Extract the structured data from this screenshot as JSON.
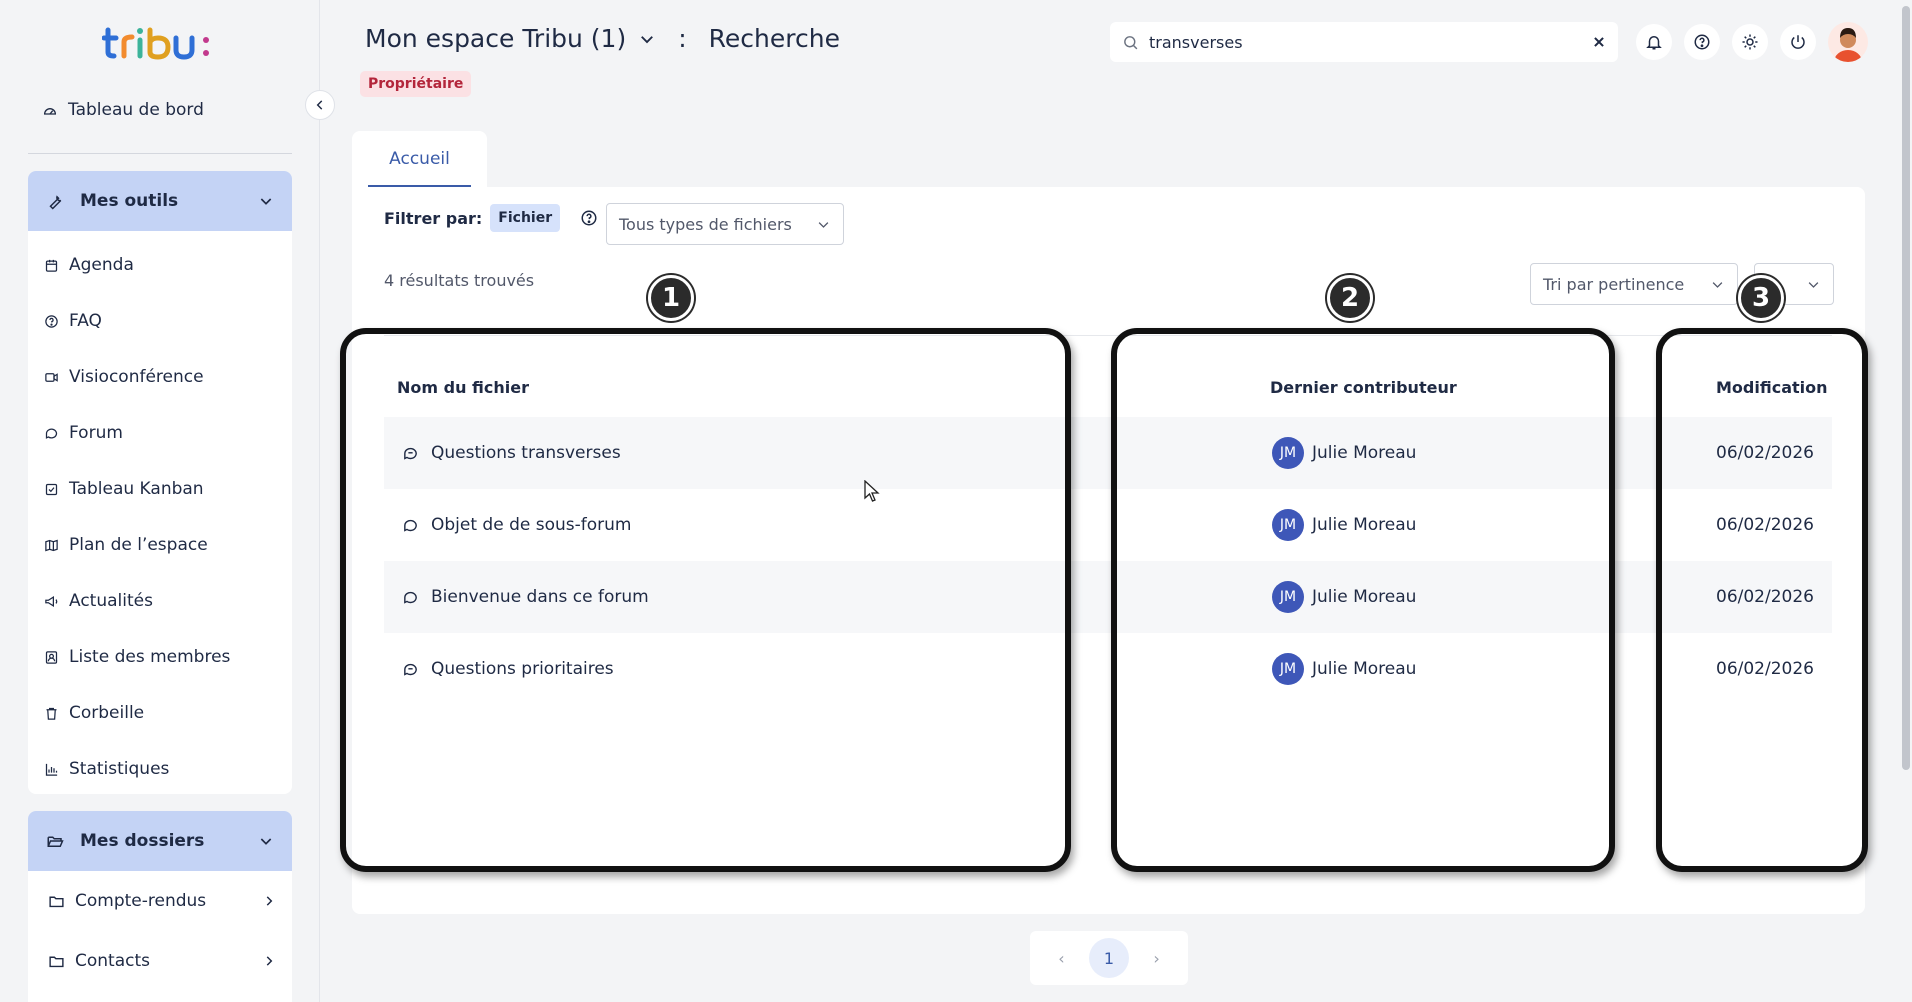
{
  "sidebar": {
    "dashboard_label": "Tableau de bord",
    "tools": {
      "header": "Mes outils",
      "items": [
        "Agenda",
        "FAQ",
        "Visioconférence",
        "Forum",
        "Tableau Kanban",
        "Plan de l’espace",
        "Actualités",
        "Liste des membres",
        "Corbeille",
        "Statistiques"
      ]
    },
    "folders": {
      "header": "Mes dossiers",
      "items": [
        "Compte-rendus",
        "Contacts"
      ]
    }
  },
  "header": {
    "space_title": "Mon espace Tribu (1)",
    "separator": ":",
    "page_title": "Recherche",
    "role_badge": "Propriétaire",
    "search_value": "transverses"
  },
  "tabs": {
    "home": "Accueil"
  },
  "filter": {
    "label": "Filtrer par:",
    "chip": "Fichier",
    "type_select": "Tous types de fichiers",
    "sort_select": "Tri par pertinence",
    "results_count": "4 résultats trouvés"
  },
  "table": {
    "headers": {
      "name": "Nom du fichier",
      "contributor": "Dernier contributeur",
      "modified": "Modification"
    },
    "rows": [
      {
        "name": "Questions transverses",
        "icon": "forum-icon",
        "initials": "JM",
        "contributor": "Julie Moreau",
        "date": "06/02/2026"
      },
      {
        "name": "Objet de de sous-forum",
        "icon": "comment-icon",
        "initials": "JM",
        "contributor": "Julie Moreau",
        "date": "06/02/2026"
      },
      {
        "name": "Bienvenue dans ce forum",
        "icon": "comment-icon",
        "initials": "JM",
        "contributor": "Julie Moreau",
        "date": "06/02/2026"
      },
      {
        "name": "Questions prioritaires",
        "icon": "forum-icon",
        "initials": "JM",
        "contributor": "Julie Moreau",
        "date": "06/02/2026"
      }
    ]
  },
  "annotations": [
    "1",
    "2",
    "3"
  ],
  "pagination": {
    "current": "1",
    "prev": "‹",
    "next": "›"
  },
  "colors": {
    "accent": "#3a5ba8",
    "group_header": "#c4d3f5",
    "avatar_bg": "#3e57b8",
    "role_badge": "#b3263b"
  }
}
